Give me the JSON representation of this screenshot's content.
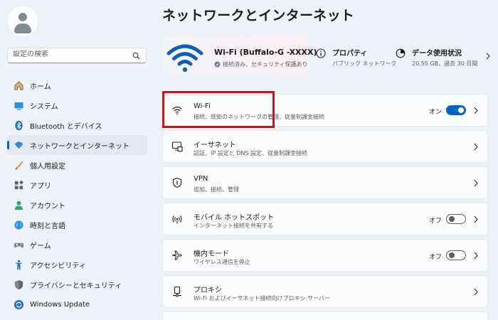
{
  "sidebar": {
    "search_placeholder": "設定の検索",
    "items": [
      {
        "label": "ホーム",
        "icon": "home-icon"
      },
      {
        "label": "システム",
        "icon": "system-icon"
      },
      {
        "label": "Bluetooth とデバイス",
        "icon": "bluetooth-icon"
      },
      {
        "label": "ネットワークとインターネット",
        "icon": "network-icon",
        "active": true
      },
      {
        "label": "個人用設定",
        "icon": "brush-icon"
      },
      {
        "label": "アプリ",
        "icon": "apps-icon"
      },
      {
        "label": "アカウント",
        "icon": "account-icon"
      },
      {
        "label": "時刻と言語",
        "icon": "globe-icon"
      },
      {
        "label": "ゲーム",
        "icon": "gamepad-icon"
      },
      {
        "label": "アクセシビリティ",
        "icon": "accessibility-icon"
      },
      {
        "label": "プライバシーとセキュリティ",
        "icon": "shield-icon"
      },
      {
        "label": "Windows Update",
        "icon": "update-icon"
      }
    ]
  },
  "page": {
    "title": "ネットワークとインターネット"
  },
  "hero": {
    "ssid": "Wi-Fi (Buffalo-G -XXXX)",
    "status": "接続済み、セキュリティ保護あり",
    "properties_title": "プロパティ",
    "properties_sub": "パブリック ネットワーク",
    "usage_title": "データ使用状況",
    "usage_sub": "20.55 GB、過去 30 日間"
  },
  "cards": [
    {
      "title": "Wi-Fi",
      "sub": "接続、既知のネットワークの管理、従量制課金接続",
      "icon": "wifi-icon",
      "toggle": "オン"
    },
    {
      "title": "イーサネット",
      "sub": "認証、IP 設定と DNS 設定、従量制課金接続",
      "icon": "ethernet-icon"
    },
    {
      "title": "VPN",
      "sub": "追加、接続、管理",
      "icon": "vpn-shield-icon"
    },
    {
      "title": "モバイル ホットスポット",
      "sub": "インターネット接続を共有する",
      "icon": "hotspot-icon",
      "toggle": "オフ"
    },
    {
      "title": "機内モード",
      "sub": "ワイヤレス通信を停止",
      "icon": "airplane-icon",
      "toggle": "オフ"
    },
    {
      "title": "プロキシ",
      "sub": "Wi-Fi およびイーサネット接続向けプロキシ サーバー",
      "icon": "proxy-icon"
    }
  ],
  "colors": {
    "accent": "#0067c0",
    "highlight": "#d01515"
  }
}
